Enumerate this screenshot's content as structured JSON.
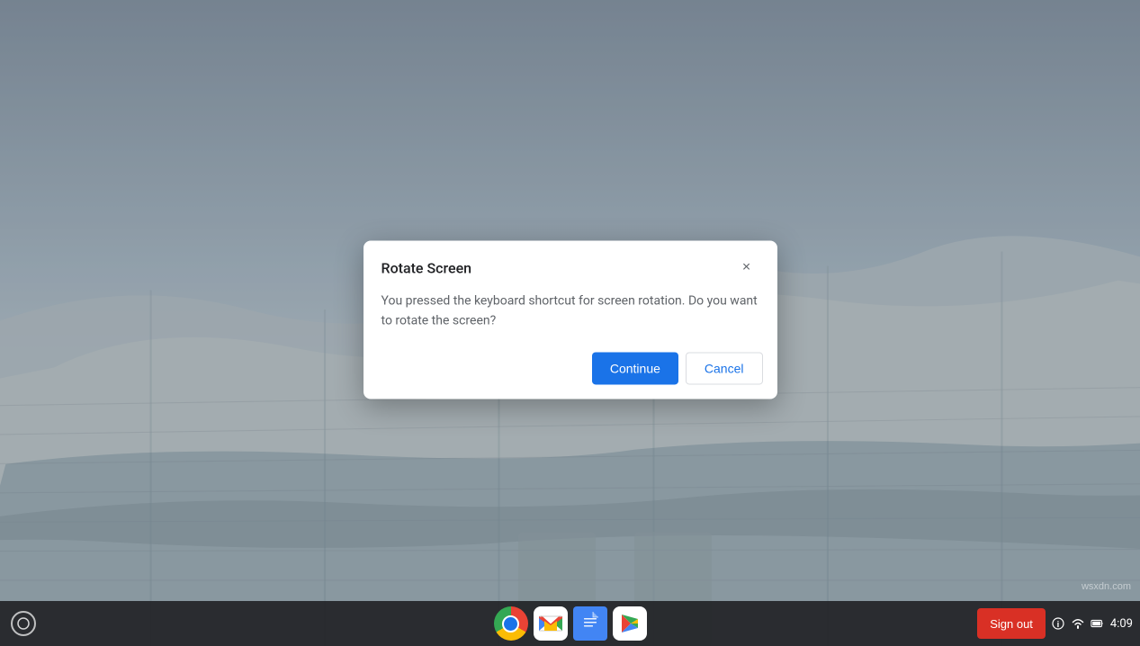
{
  "desktop": {
    "background_description": "Modern building architecture photo"
  },
  "dialog": {
    "title": "Rotate Screen",
    "message": "You pressed the keyboard shortcut for screen rotation. Do you want to rotate the screen?",
    "continue_label": "Continue",
    "cancel_label": "Cancel",
    "close_icon": "×"
  },
  "taskbar": {
    "launcher_label": "Launcher",
    "apps": [
      {
        "name": "Chrome",
        "label": "Google Chrome"
      },
      {
        "name": "Gmail",
        "label": "Gmail"
      },
      {
        "name": "Docs",
        "label": "Google Docs"
      },
      {
        "name": "Play",
        "label": "Play Store"
      }
    ],
    "sign_out_label": "Sign out",
    "time": "4:09",
    "tray": {
      "info_icon": "ℹ",
      "wifi_icon": "wifi",
      "battery_icon": "battery"
    }
  },
  "watermark": "wsxdn.com"
}
